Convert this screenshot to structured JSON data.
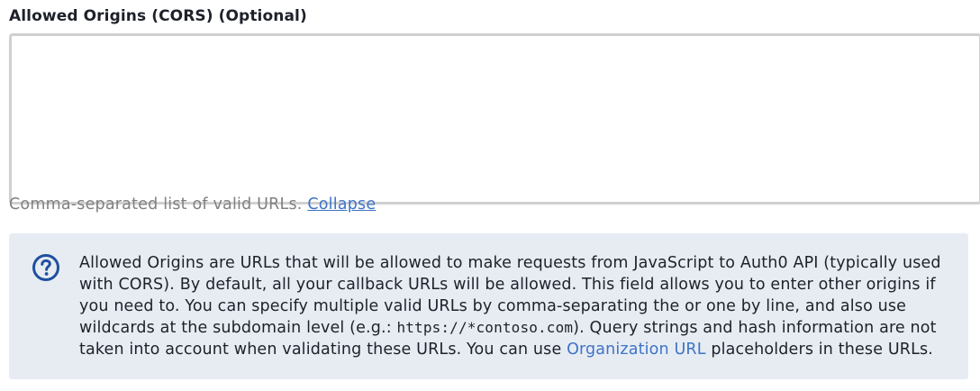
{
  "field": {
    "label": "Allowed Origins (CORS) (Optional)",
    "value": "",
    "placeholder": ""
  },
  "helper": {
    "text": "Comma-separated list of valid URLs.",
    "collapse_link": "Collapse"
  },
  "info": {
    "icon": "question-circle-icon",
    "text_1": "Allowed Origins are URLs that will be allowed to make requests from JavaScript to Auth0 API (typically used with CORS). By default, all your callback URLs will be allowed. This field allows you to enter other origins if you need to. You can specify multiple valid URLs by comma-separating the or one by line, and also use wildcards at the subdomain level (e.g.: ",
    "code_example": "https://*contoso.com",
    "text_2": "). Query strings and hash information are not taken into account when validating these URLs. You can use ",
    "link": "Organization URL",
    "text_3": " placeholders in these URLs."
  },
  "colors": {
    "accent": "#3e73c7",
    "info_bg": "#e7ecf3",
    "icon": "#1f4f9e"
  }
}
